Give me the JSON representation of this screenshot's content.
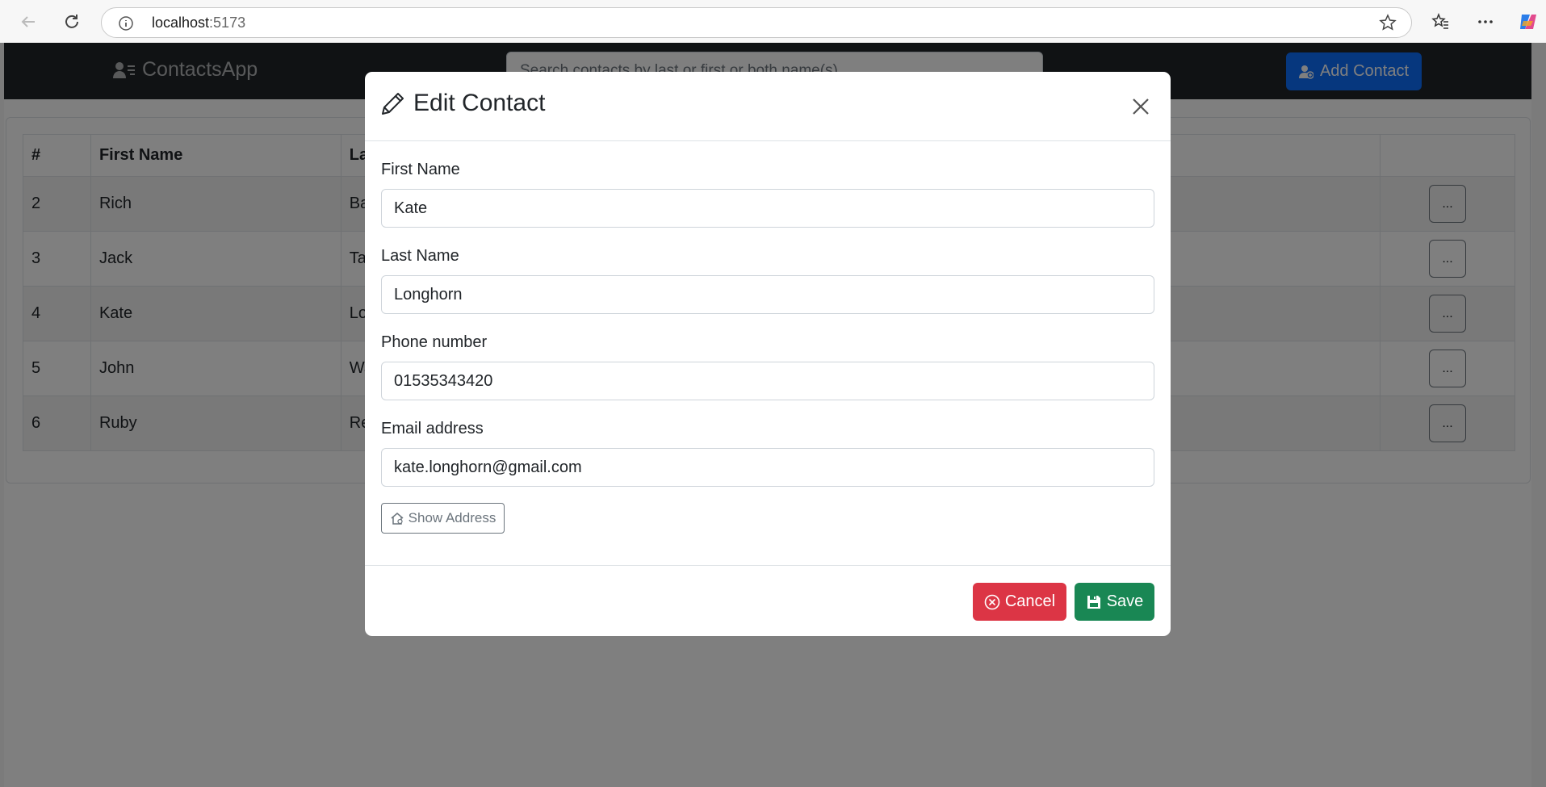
{
  "browser": {
    "url_host": "localhost",
    "url_port": ":5173"
  },
  "navbar": {
    "brand": "ContactsApp",
    "search_placeholder": "Search contacts by last or first or both name(s)",
    "add_label": "Add Contact"
  },
  "table": {
    "headers": [
      "#",
      "First Name",
      "Las"
    ],
    "rows": [
      {
        "id": "2",
        "first": "Rich",
        "last": "Ba"
      },
      {
        "id": "3",
        "first": "Jack",
        "last": "Tar"
      },
      {
        "id": "4",
        "first": "Kate",
        "last": "Lo"
      },
      {
        "id": "5",
        "first": "John",
        "last": "Wa"
      },
      {
        "id": "6",
        "first": "Ruby",
        "last": "Re"
      }
    ],
    "action_label": "..."
  },
  "modal": {
    "title": "Edit Contact",
    "fields": {
      "first_name": {
        "label": "First Name",
        "value": "Kate"
      },
      "last_name": {
        "label": "Last Name",
        "value": "Longhorn"
      },
      "phone": {
        "label": "Phone number",
        "value": "01535343420"
      },
      "email": {
        "label": "Email address",
        "value": "kate.longhorn@gmail.com"
      }
    },
    "show_address_label": "Show Address",
    "cancel_label": "Cancel",
    "save_label": "Save"
  },
  "colors": {
    "navbar": "#212529",
    "primary": "#0d6efd",
    "danger": "#dc3545",
    "success": "#198754"
  },
  "icons": {
    "brand": "person-lines-icon",
    "add": "person-add-icon",
    "title": "pencil-icon",
    "close": "close-icon",
    "show_address": "house-icon",
    "cancel": "x-circle-icon",
    "save": "floppy-disk-icon"
  }
}
